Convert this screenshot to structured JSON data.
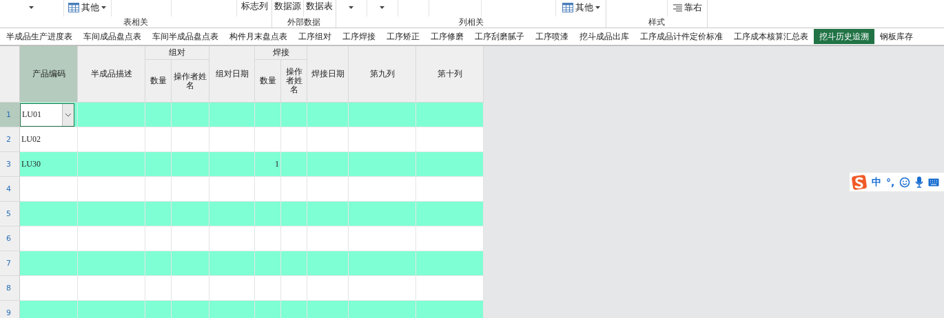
{
  "ribbon": {
    "groups": [
      {
        "label": "表相关",
        "items": [
          {
            "kind": "caret"
          },
          {
            "kind": "menu",
            "label": "其他"
          },
          {
            "kind": "label",
            "label": "标志列"
          }
        ]
      },
      {
        "label": "外部数据",
        "items": [
          {
            "kind": "label",
            "label": "数据源"
          },
          {
            "kind": "label",
            "label": "数据表"
          }
        ]
      },
      {
        "label": "列相关",
        "items": [
          {
            "kind": "caret"
          },
          {
            "kind": "caret"
          },
          {
            "kind": "menu",
            "label": "其他"
          }
        ]
      },
      {
        "label": "样式",
        "items": [
          {
            "kind": "align",
            "label": "靠右"
          }
        ]
      }
    ]
  },
  "tabs": [
    {
      "label": "半成品生产进度表",
      "selected": false
    },
    {
      "label": "车间成品盘点表",
      "selected": false
    },
    {
      "label": "车间半成品盘点表",
      "selected": false
    },
    {
      "label": "构件月末盘点表",
      "selected": false
    },
    {
      "label": "工序组对",
      "selected": false
    },
    {
      "label": "工序焊接",
      "selected": false
    },
    {
      "label": "工序矫正",
      "selected": false
    },
    {
      "label": "工序修磨",
      "selected": false
    },
    {
      "label": "工序刮磨腻子",
      "selected": false
    },
    {
      "label": "工序喷漆",
      "selected": false
    },
    {
      "label": "挖斗成品出库",
      "selected": false
    },
    {
      "label": "工序成品计件定价标准",
      "selected": false
    },
    {
      "label": "工序成本核算汇总表",
      "selected": false
    },
    {
      "label": "挖斗历史追溯",
      "selected": true
    },
    {
      "label": "钢板库存",
      "selected": false
    }
  ],
  "table": {
    "columns": [
      {
        "label": "产品编码"
      },
      {
        "label": "半成品描述"
      },
      {
        "group": "组对",
        "labels": [
          "数量",
          "操作者姓名"
        ]
      },
      {
        "label": "组对日期"
      },
      {
        "group": "焊接",
        "labels": [
          "数量",
          "操作者姓名"
        ]
      },
      {
        "label": "焊接日期"
      },
      {
        "label": "第九列"
      },
      {
        "label": "第十列"
      }
    ],
    "rows": [
      {
        "number": "1",
        "code": "LU01",
        "weld_qty": null,
        "shaded": true,
        "selected": true
      },
      {
        "number": "2",
        "code": "LU02",
        "weld_qty": null,
        "shaded": false,
        "selected": false
      },
      {
        "number": "3",
        "code": "LU30",
        "weld_qty": "1",
        "shaded": true,
        "selected": false
      },
      {
        "number": "4",
        "code": null,
        "weld_qty": null,
        "shaded": false,
        "selected": false
      },
      {
        "number": "5",
        "code": null,
        "weld_qty": null,
        "shaded": true,
        "selected": false
      },
      {
        "number": "6",
        "code": null,
        "weld_qty": null,
        "shaded": false,
        "selected": false
      },
      {
        "number": "7",
        "code": null,
        "weld_qty": null,
        "shaded": true,
        "selected": false
      },
      {
        "number": "8",
        "code": null,
        "weld_qty": null,
        "shaded": false,
        "selected": false
      },
      {
        "number": "9",
        "code": null,
        "weld_qty": null,
        "shaded": true,
        "selected": false
      }
    ]
  },
  "ime_bar": {
    "language": "中",
    "punctuation": "°,"
  }
}
